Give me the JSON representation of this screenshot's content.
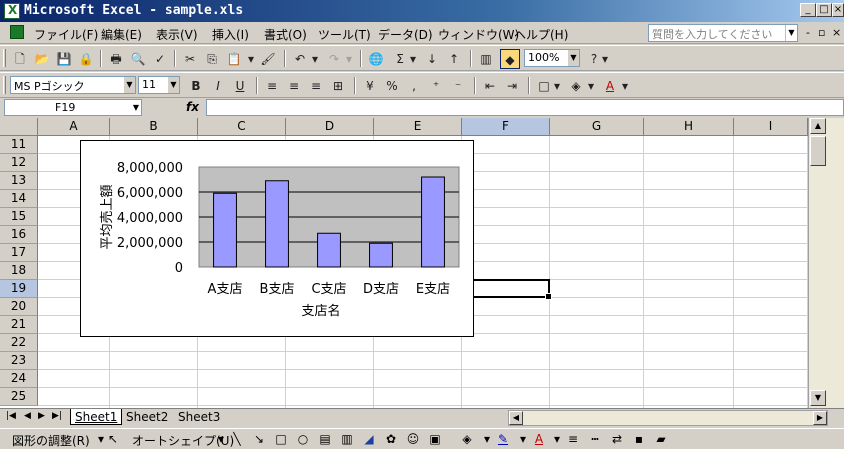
{
  "window": {
    "title": "Microsoft Excel - sample.xls"
  },
  "menu": {
    "items": [
      "ファイル(F)",
      "編集(E)",
      "表示(V)",
      "挿入(I)",
      "書式(O)",
      "ツール(T)",
      "データ(D)",
      "ウィンドウ(W)",
      "ヘルプ(H)"
    ],
    "help_placeholder": "質問を入力してください"
  },
  "toolbar": {
    "zoom": "100%",
    "font_name": "MS Pゴシック",
    "font_size": "11"
  },
  "formula": {
    "name_box": "F19",
    "fx_label": "fx",
    "content": ""
  },
  "grid": {
    "columns": [
      "A",
      "B",
      "C",
      "D",
      "E",
      "F",
      "G",
      "H",
      "I"
    ],
    "rows": [
      "11",
      "12",
      "13",
      "14",
      "15",
      "16",
      "17",
      "18",
      "19",
      "20",
      "21",
      "22",
      "23",
      "24",
      "25"
    ],
    "selected_column": "F",
    "selected_row": "19"
  },
  "sheets": {
    "tabs": [
      "Sheet1",
      "Sheet2",
      "Sheet3"
    ],
    "active": "Sheet1"
  },
  "drawing": {
    "adjust_label": "図形の調整(R)",
    "autoshape_label": "オートシェイプ(U)"
  },
  "chart_data": {
    "type": "bar",
    "categories": [
      "A支店",
      "B支店",
      "C支店",
      "D支店",
      "E支店"
    ],
    "values": [
      5900000,
      6900000,
      2700000,
      1900000,
      7200000
    ],
    "xlabel": "支店名",
    "ylabel": "平均売上額",
    "ylim": [
      0,
      8000000
    ],
    "yticks": [
      "0",
      "2,000,000",
      "4,000,000",
      "6,000,000",
      "8,000,000"
    ],
    "bar_color": "#9999ff",
    "plot_background": "#c0c0c0",
    "grid": true,
    "legend": "none"
  }
}
